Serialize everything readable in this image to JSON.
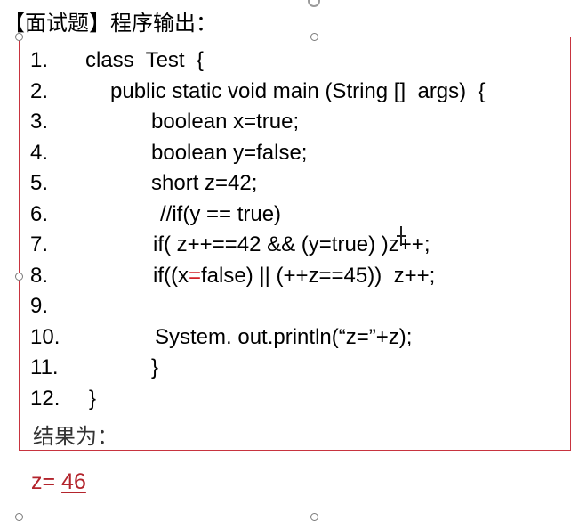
{
  "title": "【面试题】程序输出：",
  "code_lines": [
    {
      "num": "1.",
      "code": "class  Test  {"
    },
    {
      "num": "2.",
      "code": "public static void main (String []  args)  {"
    },
    {
      "num": "3.",
      "code": "boolean x=true;"
    },
    {
      "num": "4.",
      "code": "boolean y=false;"
    },
    {
      "num": "5.",
      "code": "short z=42;"
    },
    {
      "num": "6.",
      "code": "//if(y == true)"
    },
    {
      "num": "7.",
      "code": "if( z++==42 && (y=true) )z++;"
    },
    {
      "num": "8.",
      "pre": "if((x",
      "red": "=",
      "post": "false) || (++z==45))  z++;"
    },
    {
      "num": "9.",
      "code": ""
    },
    {
      "num": "10.",
      "code": "System. out.println(“z=”+z);"
    },
    {
      "num": "11.",
      "code": "}"
    },
    {
      "num": "12.",
      "code": "}"
    }
  ],
  "result_label": "结果为：",
  "answer": {
    "prefix": "z= ",
    "value": "46"
  },
  "colors": {
    "border": "#c8343f",
    "answer": "#b3242c",
    "highlight": "#d21f27"
  }
}
